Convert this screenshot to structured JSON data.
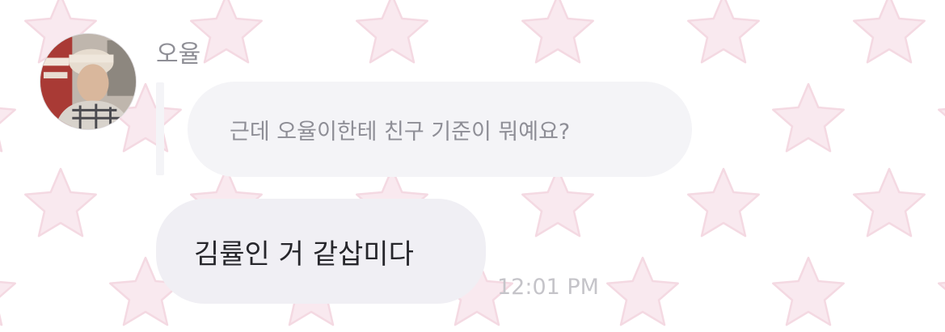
{
  "background": {
    "pattern_icon": "star-icon",
    "star_color": "#f9e9ef",
    "star_outline_color": "#f4d9e2",
    "base_color": "#ffffff"
  },
  "chat": {
    "sender": {
      "name": "오율",
      "avatar_icon": "profile-photo"
    },
    "reply": {
      "quoted_text": "근데 오율이한테 친구 기준이 뭐예요?"
    },
    "message": {
      "text": "김률인 거 같삽미다",
      "time": "12:01 PM"
    }
  },
  "colors": {
    "bubble": "#f0eff4",
    "quoted_bubble": "#f4f4f7",
    "name_text": "#8f8f96",
    "message_text": "#26262b",
    "timestamp_text": "#c5c4c9"
  }
}
